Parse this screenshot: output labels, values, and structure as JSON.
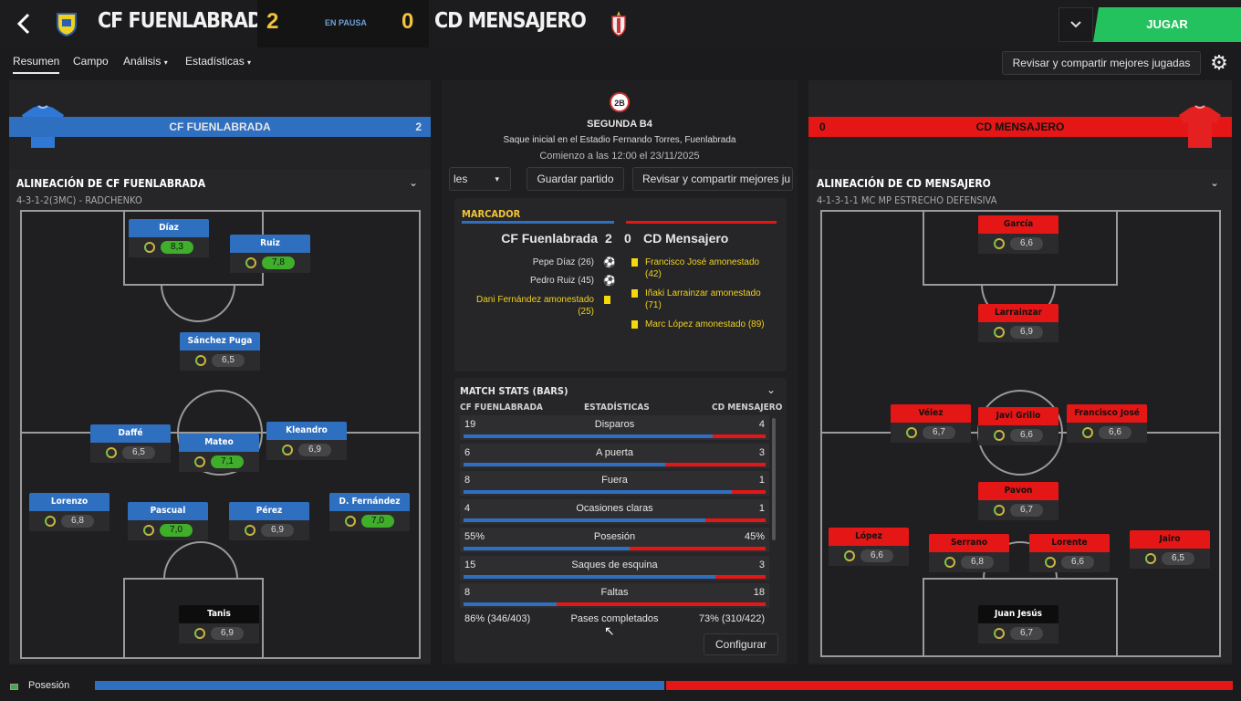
{
  "header": {
    "home_team": "CF FUENLABRADA",
    "home_score": "2",
    "status": "EN PAUSA",
    "away_score": "0",
    "away_team": "CD MENSAJERO",
    "play_button": "JUGAR",
    "back_icon": "back-arrow-icon",
    "dropdown_icon": "chevron-down-icon"
  },
  "tabs": [
    {
      "label": "Resumen"
    },
    {
      "label": "Campo"
    },
    {
      "label": "Análisis"
    },
    {
      "label": "Estadísticas"
    }
  ],
  "share_button": "Revisar y compartir mejores jugadas",
  "colors": {
    "home": "#2f6fc0",
    "away": "#e51616",
    "accent_green": "#24c25f",
    "rating_good": "#3fae2a"
  },
  "match_info": {
    "competition": "SEGUNDA B4",
    "venue": "Saque inicial en el Estadio Fernando Torres, Fuenlabrada",
    "kickoff": "Comienzo a las 12:00 el 23/11/2025",
    "dropdown_label": "les",
    "save_button": "Guardar partido",
    "share_button": "Revisar y compartir mejores ju"
  },
  "home_bar": {
    "name": "CF FUENLABRADA",
    "score": "2"
  },
  "away_bar": {
    "name": "CD MENSAJERO",
    "score": "0"
  },
  "home_lineup": {
    "title": "ALINEACIÓN DE CF FUENLABRADA",
    "formation": "4-3-1-2(3MC) - RADCHENKO",
    "players": [
      {
        "name": "Díaz",
        "rating": "8,3",
        "good": true
      },
      {
        "name": "Ruiz",
        "rating": "7,8",
        "good": true
      },
      {
        "name": "Sánchez Puga",
        "rating": "6,5",
        "good": false
      },
      {
        "name": "Daffé",
        "rating": "6,5",
        "good": false
      },
      {
        "name": "Mateo",
        "rating": "7,1",
        "good": true
      },
      {
        "name": "Kleandro",
        "rating": "6,9",
        "good": false
      },
      {
        "name": "Lorenzo",
        "rating": "6,8",
        "good": false
      },
      {
        "name": "Pascual",
        "rating": "7,0",
        "good": true
      },
      {
        "name": "Pérez",
        "rating": "6,9",
        "good": false
      },
      {
        "name": "D. Fernández",
        "rating": "7,0",
        "good": true
      },
      {
        "name": "Tanis",
        "rating": "6,9",
        "good": false
      }
    ]
  },
  "away_lineup": {
    "title": "ALINEACIÓN DE CD MENSAJERO",
    "formation": "4-1-3-1-1 MC MP ESTRECHO DEFENSIVA",
    "players": [
      {
        "name": "García",
        "rating": "6,6"
      },
      {
        "name": "Larrainzar",
        "rating": "6,9"
      },
      {
        "name": "Vélez",
        "rating": "6,7"
      },
      {
        "name": "Javi Grillo",
        "rating": "6,6"
      },
      {
        "name": "Francisco José",
        "rating": "6,6"
      },
      {
        "name": "Pavon",
        "rating": "6,7"
      },
      {
        "name": "López",
        "rating": "6,6"
      },
      {
        "name": "Serrano",
        "rating": "6,8"
      },
      {
        "name": "Lorente",
        "rating": "6,6"
      },
      {
        "name": "Jairo",
        "rating": "6,5"
      },
      {
        "name": "Juan Jesús",
        "rating": "6,7"
      }
    ]
  },
  "scoreboard": {
    "title": "MARCADOR",
    "home": "CF Fuenlabrada",
    "home_score": "2",
    "away_score": "0",
    "away": "CD Mensajero",
    "home_events": [
      "Pepe Díaz (26)",
      "Pedro Ruiz (45)",
      "Dani Fernández amonestado\n(25)"
    ],
    "away_events": [
      "Francisco José amonestado\n(42)",
      "Iñaki Larrainzar amonestado\n(71)",
      "Marc López amonestado (89)"
    ]
  },
  "stats": {
    "title": "MATCH STATS (BARS)",
    "col_home": "CF FUENLABRADA",
    "col_mid": "ESTADÍSTICAS",
    "col_away": "CD MENSAJERO",
    "rows": [
      {
        "home": "19",
        "label": "Disparos",
        "away": "4",
        "share": 0.826
      },
      {
        "home": "6",
        "label": "A puerta",
        "away": "3",
        "share": 0.667
      },
      {
        "home": "8",
        "label": "Fuera",
        "away": "1",
        "share": 0.889
      },
      {
        "home": "4",
        "label": "Ocasiones claras",
        "away": "1",
        "share": 0.8
      },
      {
        "home": "55%",
        "label": "Posesión",
        "away": "45%",
        "share": 0.55
      },
      {
        "home": "15",
        "label": "Saques de esquina",
        "away": "3",
        "share": 0.833
      },
      {
        "home": "8",
        "label": "Faltas",
        "away": "18",
        "share": 0.308
      }
    ],
    "passes": {
      "home": "86% (346/403)",
      "label": "Pases completados",
      "away": "73% (310/422)"
    },
    "configure": "Configurar"
  },
  "footer": {
    "label": "Posesión",
    "home_share": 0.5
  }
}
